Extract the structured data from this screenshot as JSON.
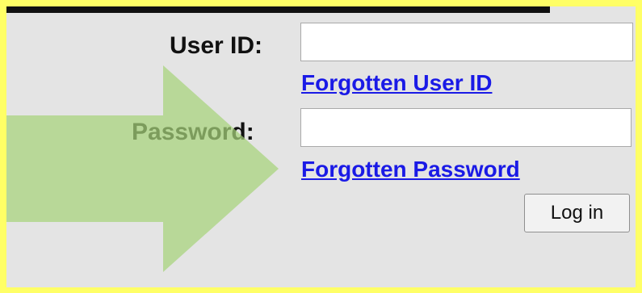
{
  "login": {
    "user_id_label": "User ID:",
    "user_id_value": "",
    "forgotten_user_id_link": "Forgotten User ID",
    "password_label": "Password:",
    "password_value": "",
    "forgotten_password_link": "Forgotten Password",
    "login_button": "Log in"
  },
  "colors": {
    "border_highlight": "#ffff66",
    "panel_background": "#e4e4e4",
    "link": "#1a1ae6",
    "arrow": "#a6d27a"
  },
  "icons": {
    "arrow": "right-arrow-icon"
  }
}
